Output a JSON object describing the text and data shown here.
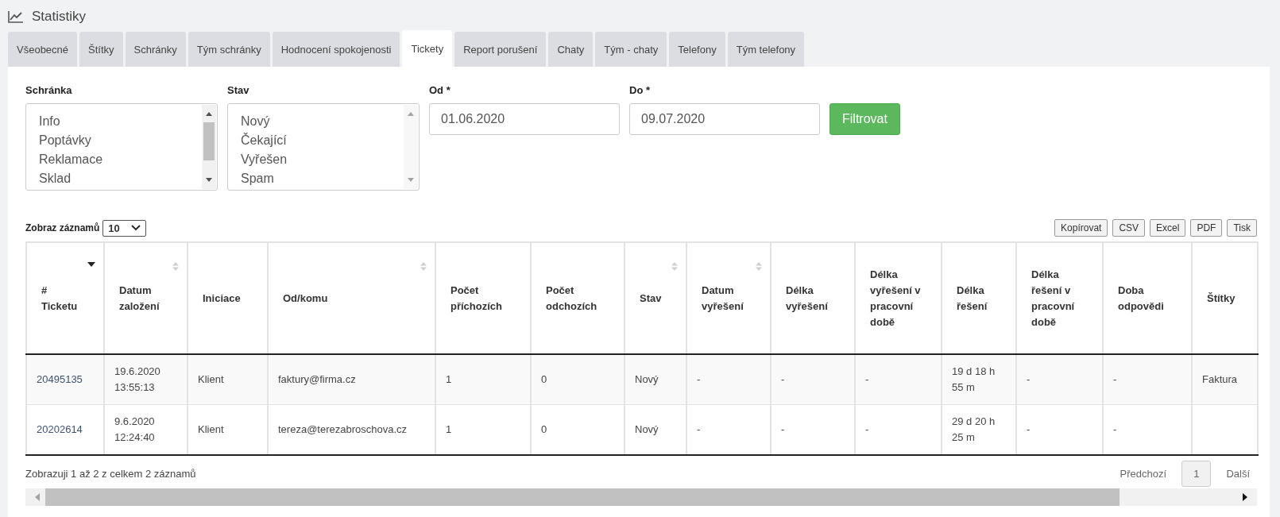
{
  "page": {
    "title": "Statistiky"
  },
  "tabs": [
    {
      "label": "Všeobecné",
      "selected": false
    },
    {
      "label": "Štítky",
      "selected": false
    },
    {
      "label": "Schránky",
      "selected": false
    },
    {
      "label": "Tým schránky",
      "selected": false
    },
    {
      "label": "Hodnocení spokojenosti",
      "selected": false
    },
    {
      "label": "Tickety",
      "selected": true
    },
    {
      "label": "Report porušení",
      "selected": false
    },
    {
      "label": "Chaty",
      "selected": false
    },
    {
      "label": "Tým - chaty",
      "selected": false
    },
    {
      "label": "Telefony",
      "selected": false
    },
    {
      "label": "Tým telefony",
      "selected": false
    }
  ],
  "filters": {
    "mailbox": {
      "label": "Schránka",
      "options": [
        "Info",
        "Poptávky",
        "Reklamace",
        "Sklad"
      ]
    },
    "state": {
      "label": "Stav",
      "options": [
        "Nový",
        "Čekající",
        "Vyřešen",
        "Spam"
      ]
    },
    "from": {
      "label": "Od",
      "required_mark": "*",
      "value": "01.06.2020"
    },
    "to": {
      "label": "Do",
      "required_mark": "*",
      "value": "09.07.2020"
    },
    "button": "Filtrovat"
  },
  "table_controls": {
    "length_label": "Zobraz záznamů",
    "length_value": "10",
    "export_buttons": [
      "Kopírovat",
      "CSV",
      "Excel",
      "PDF",
      "Tisk"
    ]
  },
  "table": {
    "columns": [
      {
        "label": "# Ticketu",
        "sortable": true,
        "sorted": true
      },
      {
        "label": "Datum založení",
        "sortable": true,
        "sorted": false
      },
      {
        "label": "Iniciace",
        "sortable": false,
        "sorted": false
      },
      {
        "label": "Od/komu",
        "sortable": true,
        "sorted": false
      },
      {
        "label": "Počet příchozích",
        "sortable": false,
        "sorted": false
      },
      {
        "label": "Počet odchozích",
        "sortable": false,
        "sorted": false
      },
      {
        "label": "Stav",
        "sortable": true,
        "sorted": false
      },
      {
        "label": "Datum vyřešení",
        "sortable": true,
        "sorted": false
      },
      {
        "label": "Délka vyřešení",
        "sortable": false,
        "sorted": false
      },
      {
        "label": "Délka vyřešení v pracovní době",
        "sortable": false,
        "sorted": false
      },
      {
        "label": "Délka řešení",
        "sortable": false,
        "sorted": false
      },
      {
        "label": "Délka řešení v pracovní době",
        "sortable": false,
        "sorted": false
      },
      {
        "label": "Doba odpovědi",
        "sortable": false,
        "sorted": false
      },
      {
        "label": "Štítky",
        "sortable": false,
        "sorted": false
      }
    ],
    "rows": [
      [
        "20495135",
        "19.6.2020 13:55:13",
        "Klient",
        "faktury@firma.cz",
        "1",
        "0",
        "Nový",
        "-",
        "-",
        "-",
        "19 d 18 h 55 m",
        "-",
        "-",
        "Faktura"
      ],
      [
        "20202614",
        "9.6.2020 12:24:40",
        "Klient",
        "tereza@terezabroschova.cz",
        "1",
        "0",
        "Nový",
        "-",
        "-",
        "-",
        "29 d 20 h 25 m",
        "-",
        "-",
        ""
      ]
    ]
  },
  "footer": {
    "info": "Zobrazuji 1 až 2 z celkem 2 záznamů",
    "pagination": [
      {
        "label": "Předchozí",
        "selected": false
      },
      {
        "label": "1",
        "selected": true
      },
      {
        "label": "Další",
        "selected": false
      }
    ]
  }
}
